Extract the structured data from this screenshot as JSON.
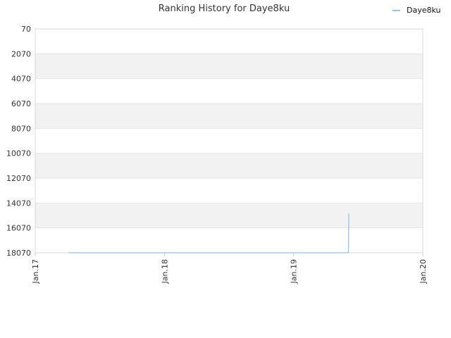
{
  "chart_data": {
    "type": "line",
    "title": "Ranking History for Daye8ku",
    "xlabel": "",
    "ylabel": "",
    "y_reversed": true,
    "ylim": [
      70,
      18070
    ],
    "y_ticks": [
      70,
      2070,
      4070,
      6070,
      8070,
      10070,
      12070,
      14070,
      16070,
      18070
    ],
    "y_tick_labels": [
      "70",
      "2070",
      "4070",
      "6070",
      "8070",
      "10070",
      "12070",
      "14070",
      "16070",
      "18070"
    ],
    "x_ticks": [
      "2017-01-01",
      "2018-01-01",
      "2019-01-01",
      "2020-01-01"
    ],
    "x_tick_labels": [
      "Jan.17",
      "Jan.18",
      "Jan.19",
      "Jan.20"
    ],
    "xlim": [
      "2017-01-01",
      "2020-01-01"
    ],
    "grid": "horizontal, alternating band shading",
    "legend": {
      "placement": "top-right"
    },
    "series": [
      {
        "name": "Daye8ku",
        "color": "#90c4ec",
        "points": [
          {
            "x": "2017-04-05",
            "y": 18070
          },
          {
            "x": "2019-06-05",
            "y": 18070
          },
          {
            "x": "2019-06-06",
            "y": 14900
          }
        ]
      }
    ],
    "colors": {
      "band": "#f2f2f2",
      "gridline": "#e4e4e4",
      "axis": "#cccccc"
    }
  }
}
